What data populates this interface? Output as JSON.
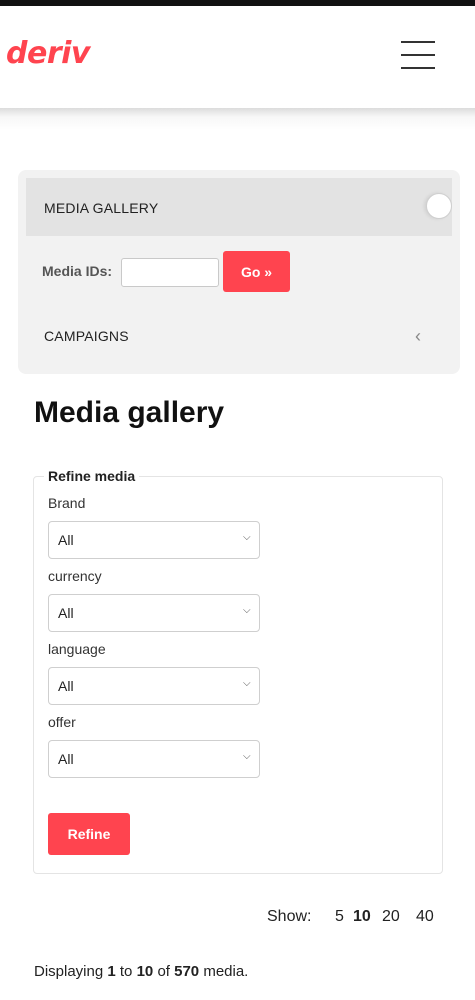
{
  "brand": {
    "logo_text": "deriv",
    "accent_color": "#ff444f"
  },
  "header": {
    "menu_icon": "hamburger-icon"
  },
  "side_panel": {
    "media_gallery_label": "MEDIA GALLERY",
    "media_ids_label": "Media IDs:",
    "media_ids_value": "",
    "go_label": "Go »",
    "campaigns_label": "CAMPAIGNS"
  },
  "main": {
    "title": "Media gallery",
    "refine": {
      "legend": "Refine media",
      "fields": [
        {
          "label": "Brand",
          "value": "All"
        },
        {
          "label": "currency",
          "value": "All"
        },
        {
          "label": "language",
          "value": "All"
        },
        {
          "label": "offer",
          "value": "All"
        }
      ],
      "button_label": "Refine"
    },
    "show": {
      "label": "Show:",
      "options": [
        "5",
        "10",
        "20",
        "40"
      ],
      "selected": "10"
    },
    "displaying": {
      "prefix": "Displaying",
      "from": "1",
      "to_word": "to",
      "to": "10",
      "of_word": "of",
      "total": "570",
      "suffix": "media."
    }
  }
}
